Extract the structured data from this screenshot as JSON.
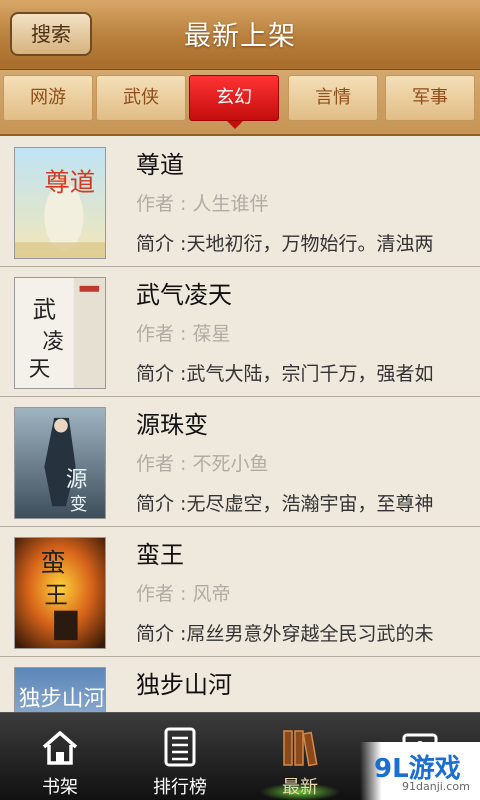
{
  "header": {
    "search_label": "搜索",
    "title": "最新上架"
  },
  "tabs": [
    {
      "label": "网游",
      "active": false
    },
    {
      "label": "武侠",
      "active": false
    },
    {
      "label": "玄幻",
      "active": true
    },
    {
      "label": "言情",
      "active": false
    },
    {
      "label": "军事",
      "active": false
    }
  ],
  "books": [
    {
      "title": "尊道",
      "author": "作者 : 人生谁伴",
      "summary": "简介 :天地初衍，万物始行。清浊两"
    },
    {
      "title": "武气凌天",
      "author": "作者 : 葆星",
      "summary": "简介 :武气大陆，宗门千万，强者如"
    },
    {
      "title": "源珠变",
      "author": "作者 : 不死小鱼",
      "summary": "简介 :无尽虚空，浩瀚宇宙，至尊神"
    },
    {
      "title": "蛮王",
      "author": "作者 : 风帝",
      "summary": "简介 :屌丝男意外穿越全民习武的未"
    },
    {
      "title": "独步山河",
      "author": "",
      "summary": ""
    }
  ],
  "covers": [
    {
      "text": "尊道",
      "icon": "cover-immortal-art"
    },
    {
      "text": "武气凌天",
      "icon": "cover-ink-calligraphy"
    },
    {
      "text": "源珠变",
      "icon": "cover-warrior-art"
    },
    {
      "text": "蛮王",
      "icon": "cover-fire-art"
    },
    {
      "text": "独步山河",
      "icon": "cover-brush-art"
    }
  ],
  "bottom_nav": [
    {
      "label": "书架",
      "icon": "home-icon"
    },
    {
      "label": "排行榜",
      "icon": "ranking-list-icon"
    },
    {
      "label": "最新",
      "icon": "books-icon",
      "active": true
    },
    {
      "label": "",
      "icon": "profile-card-icon"
    }
  ],
  "watermark": {
    "logo": "9L游戏",
    "site": "91danji.com"
  },
  "colors": {
    "header": "#c08840",
    "active_tab": "#e01818",
    "list_bg": "#efe9dd",
    "bottom_bar": "#1e1e1e"
  }
}
